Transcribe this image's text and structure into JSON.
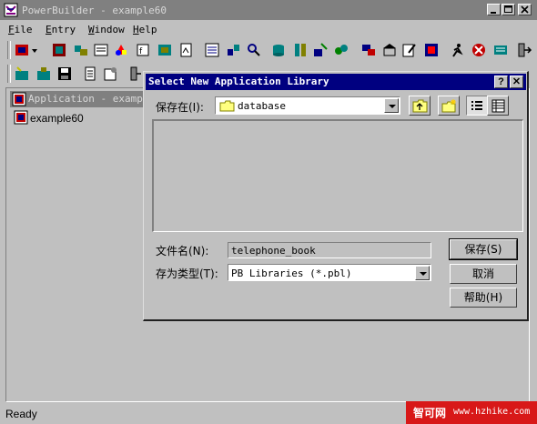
{
  "app": {
    "title": "PowerBuilder - example60"
  },
  "menu": [
    "File",
    "Entry",
    "Window",
    "Help"
  ],
  "library_window": {
    "title": "Application - example60",
    "tree_item": "example60"
  },
  "dialog": {
    "title": "Select New Application Library",
    "help_label": "?",
    "close_label": "✕",
    "look_in_label": "保存在(I):",
    "look_in_value": "database",
    "filename_label": "文件名(N):",
    "filename_value": "telephone_book",
    "filetype_label": "存为类型(T):",
    "filetype_value": "PB Libraries (*.pbl)",
    "save_label": "保存(S)",
    "cancel_label": "取消",
    "help_button_label": "帮助(H)"
  },
  "status": {
    "text": "Ready"
  },
  "watermark": {
    "brand": "智可网",
    "url": "www.hzhike.com"
  },
  "colors": {
    "dialog_title": "#000080",
    "inactive_title": "#808080",
    "watermark": "#d81818",
    "face": "#c0c0c0"
  }
}
